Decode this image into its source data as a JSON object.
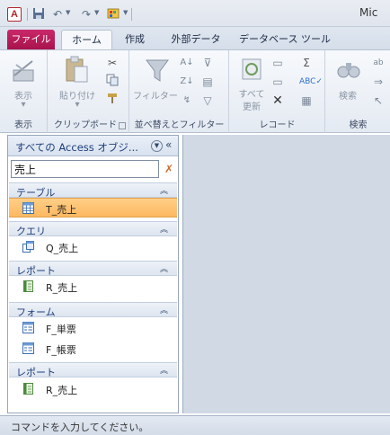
{
  "titlebar": {
    "app_icon_letter": "A",
    "title_partial": "Mic"
  },
  "tabs": [
    {
      "label": "ファイル"
    },
    {
      "label": "ホーム"
    },
    {
      "label": "作成"
    },
    {
      "label": "外部データ"
    },
    {
      "label": "データベース ツール"
    }
  ],
  "ribbon": {
    "groups": [
      {
        "label": "表示",
        "buttons": [
          "表示"
        ]
      },
      {
        "label": "クリップボード",
        "buttons": [
          "貼り付け"
        ]
      },
      {
        "label": "並べ替えとフィルター",
        "buttons": [
          "フィルター"
        ]
      },
      {
        "label": "レコード",
        "buttons": [
          "すべて",
          "更新"
        ]
      },
      {
        "label": "検索",
        "buttons": [
          "検索"
        ]
      }
    ]
  },
  "nav": {
    "title": "すべての Access オブジ...",
    "search_value": "売上",
    "groups": [
      {
        "label": "テーブル",
        "items": [
          {
            "label": "T_売上",
            "selected": true,
            "icon": "table-icon"
          }
        ]
      },
      {
        "label": "クエリ",
        "items": [
          {
            "label": "Q_売上",
            "icon": "query-icon"
          }
        ]
      },
      {
        "label": "レポート",
        "items": [
          {
            "label": "R_売上",
            "icon": "report-icon"
          }
        ]
      },
      {
        "label": "フォーム",
        "items": [
          {
            "label": "F_単票",
            "icon": "form-icon"
          },
          {
            "label": "F_帳票",
            "icon": "form-icon"
          }
        ]
      },
      {
        "label": "レポート",
        "items": [
          {
            "label": "R_売上",
            "icon": "report-icon"
          }
        ]
      }
    ]
  },
  "status": {
    "text": "コマンドを入力してください。"
  },
  "colors": {
    "file_tab": "#b8175a",
    "selected_item": "#fdc070",
    "workspace": "#d1d9e5"
  }
}
